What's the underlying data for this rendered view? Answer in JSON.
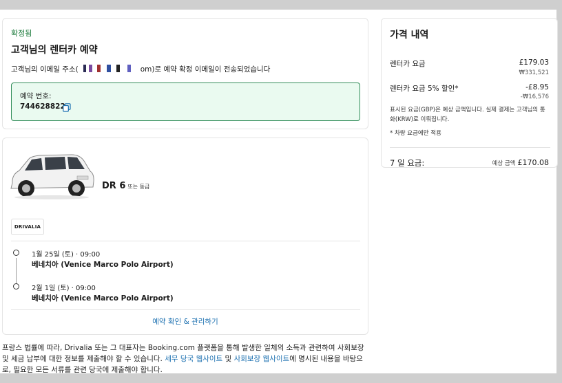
{
  "confirmation": {
    "status": "확정됨",
    "heading": "고객님의 렌터카 예약",
    "email_prefix": "고객님의 이메일 주소(",
    "email_suffix": "om)로 예약 확정 이메일이 전송되었습니다",
    "booking_label": "예약 번호:",
    "booking_number": "744628822"
  },
  "car": {
    "name": "DR 6",
    "similar": "또는 동급",
    "supplier": "DRIVALIA"
  },
  "trip": {
    "pickup_date": "1월 25일 (토) · 09:00",
    "pickup_place": "베네치아 (Venice Marco Polo Airport)",
    "dropoff_date": "2월 1일 (토) · 09:00",
    "dropoff_place": "베네치아 (Venice Marco Polo Airport)",
    "manage_link": "예약 확인 & 관리하기"
  },
  "footer": {
    "text_1": "프랑스 법률에 따라, Drivalia 또는 그 대표자는 Booking.com 플랫폼을 통해 발생한 일체의 소득과 관련하여 사회보장 및 세금 납부에 대한 정보를 제출해야 할 수 있습니다. ",
    "tax_link": "세무 당국 웹사이트",
    "and": " 및 ",
    "social_link": "사회보장 웹사이트",
    "text_2": "에 명시된 내용을 바탕으로, 필요한 모든 서류를 관련 당국에 제출해야 합니다."
  },
  "price": {
    "title": "가격 내역",
    "rental_label": "렌터카 요금",
    "rental_value": "£179.03",
    "rental_krw": "₩331,521",
    "discount_label": "렌터카 요금 5% 할인*",
    "discount_value": "-£8.95",
    "discount_krw": "-₩16,576",
    "note": "표시된 요금(GBP)은 예상 금액입니다. 실제 결제는 고객님의 통화(KRW)로 이뤄집니다.",
    "footnote": "* 차량 요금에만 적용",
    "total_label": "7 일 요금:",
    "total_est": "예상 금액",
    "total_value": "£170.08"
  }
}
